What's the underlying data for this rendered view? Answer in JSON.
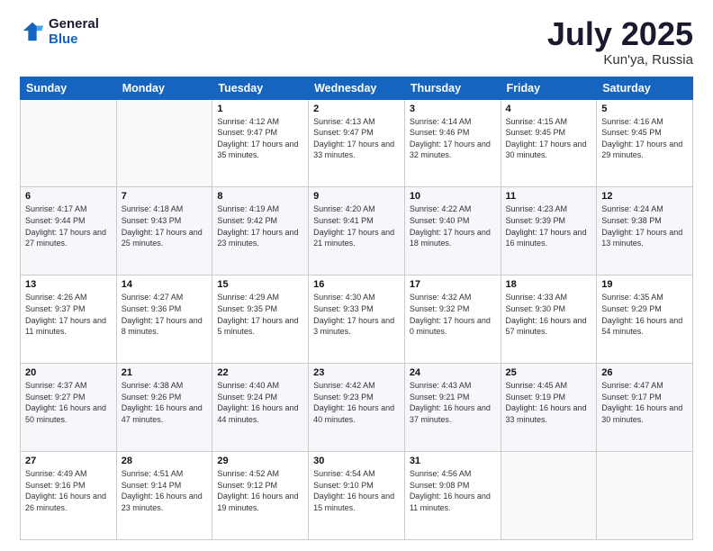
{
  "header": {
    "logo_line1": "General",
    "logo_line2": "Blue",
    "month_year": "July 2025",
    "location": "Kun'ya, Russia"
  },
  "weekdays": [
    "Sunday",
    "Monday",
    "Tuesday",
    "Wednesday",
    "Thursday",
    "Friday",
    "Saturday"
  ],
  "weeks": [
    [
      {
        "day": "",
        "sunrise": "",
        "sunset": "",
        "daylight": ""
      },
      {
        "day": "",
        "sunrise": "",
        "sunset": "",
        "daylight": ""
      },
      {
        "day": "1",
        "sunrise": "Sunrise: 4:12 AM",
        "sunset": "Sunset: 9:47 PM",
        "daylight": "Daylight: 17 hours and 35 minutes."
      },
      {
        "day": "2",
        "sunrise": "Sunrise: 4:13 AM",
        "sunset": "Sunset: 9:47 PM",
        "daylight": "Daylight: 17 hours and 33 minutes."
      },
      {
        "day": "3",
        "sunrise": "Sunrise: 4:14 AM",
        "sunset": "Sunset: 9:46 PM",
        "daylight": "Daylight: 17 hours and 32 minutes."
      },
      {
        "day": "4",
        "sunrise": "Sunrise: 4:15 AM",
        "sunset": "Sunset: 9:45 PM",
        "daylight": "Daylight: 17 hours and 30 minutes."
      },
      {
        "day": "5",
        "sunrise": "Sunrise: 4:16 AM",
        "sunset": "Sunset: 9:45 PM",
        "daylight": "Daylight: 17 hours and 29 minutes."
      }
    ],
    [
      {
        "day": "6",
        "sunrise": "Sunrise: 4:17 AM",
        "sunset": "Sunset: 9:44 PM",
        "daylight": "Daylight: 17 hours and 27 minutes."
      },
      {
        "day": "7",
        "sunrise": "Sunrise: 4:18 AM",
        "sunset": "Sunset: 9:43 PM",
        "daylight": "Daylight: 17 hours and 25 minutes."
      },
      {
        "day": "8",
        "sunrise": "Sunrise: 4:19 AM",
        "sunset": "Sunset: 9:42 PM",
        "daylight": "Daylight: 17 hours and 23 minutes."
      },
      {
        "day": "9",
        "sunrise": "Sunrise: 4:20 AM",
        "sunset": "Sunset: 9:41 PM",
        "daylight": "Daylight: 17 hours and 21 minutes."
      },
      {
        "day": "10",
        "sunrise": "Sunrise: 4:22 AM",
        "sunset": "Sunset: 9:40 PM",
        "daylight": "Daylight: 17 hours and 18 minutes."
      },
      {
        "day": "11",
        "sunrise": "Sunrise: 4:23 AM",
        "sunset": "Sunset: 9:39 PM",
        "daylight": "Daylight: 17 hours and 16 minutes."
      },
      {
        "day": "12",
        "sunrise": "Sunrise: 4:24 AM",
        "sunset": "Sunset: 9:38 PM",
        "daylight": "Daylight: 17 hours and 13 minutes."
      }
    ],
    [
      {
        "day": "13",
        "sunrise": "Sunrise: 4:26 AM",
        "sunset": "Sunset: 9:37 PM",
        "daylight": "Daylight: 17 hours and 11 minutes."
      },
      {
        "day": "14",
        "sunrise": "Sunrise: 4:27 AM",
        "sunset": "Sunset: 9:36 PM",
        "daylight": "Daylight: 17 hours and 8 minutes."
      },
      {
        "day": "15",
        "sunrise": "Sunrise: 4:29 AM",
        "sunset": "Sunset: 9:35 PM",
        "daylight": "Daylight: 17 hours and 5 minutes."
      },
      {
        "day": "16",
        "sunrise": "Sunrise: 4:30 AM",
        "sunset": "Sunset: 9:33 PM",
        "daylight": "Daylight: 17 hours and 3 minutes."
      },
      {
        "day": "17",
        "sunrise": "Sunrise: 4:32 AM",
        "sunset": "Sunset: 9:32 PM",
        "daylight": "Daylight: 17 hours and 0 minutes."
      },
      {
        "day": "18",
        "sunrise": "Sunrise: 4:33 AM",
        "sunset": "Sunset: 9:30 PM",
        "daylight": "Daylight: 16 hours and 57 minutes."
      },
      {
        "day": "19",
        "sunrise": "Sunrise: 4:35 AM",
        "sunset": "Sunset: 9:29 PM",
        "daylight": "Daylight: 16 hours and 54 minutes."
      }
    ],
    [
      {
        "day": "20",
        "sunrise": "Sunrise: 4:37 AM",
        "sunset": "Sunset: 9:27 PM",
        "daylight": "Daylight: 16 hours and 50 minutes."
      },
      {
        "day": "21",
        "sunrise": "Sunrise: 4:38 AM",
        "sunset": "Sunset: 9:26 PM",
        "daylight": "Daylight: 16 hours and 47 minutes."
      },
      {
        "day": "22",
        "sunrise": "Sunrise: 4:40 AM",
        "sunset": "Sunset: 9:24 PM",
        "daylight": "Daylight: 16 hours and 44 minutes."
      },
      {
        "day": "23",
        "sunrise": "Sunrise: 4:42 AM",
        "sunset": "Sunset: 9:23 PM",
        "daylight": "Daylight: 16 hours and 40 minutes."
      },
      {
        "day": "24",
        "sunrise": "Sunrise: 4:43 AM",
        "sunset": "Sunset: 9:21 PM",
        "daylight": "Daylight: 16 hours and 37 minutes."
      },
      {
        "day": "25",
        "sunrise": "Sunrise: 4:45 AM",
        "sunset": "Sunset: 9:19 PM",
        "daylight": "Daylight: 16 hours and 33 minutes."
      },
      {
        "day": "26",
        "sunrise": "Sunrise: 4:47 AM",
        "sunset": "Sunset: 9:17 PM",
        "daylight": "Daylight: 16 hours and 30 minutes."
      }
    ],
    [
      {
        "day": "27",
        "sunrise": "Sunrise: 4:49 AM",
        "sunset": "Sunset: 9:16 PM",
        "daylight": "Daylight: 16 hours and 26 minutes."
      },
      {
        "day": "28",
        "sunrise": "Sunrise: 4:51 AM",
        "sunset": "Sunset: 9:14 PM",
        "daylight": "Daylight: 16 hours and 23 minutes."
      },
      {
        "day": "29",
        "sunrise": "Sunrise: 4:52 AM",
        "sunset": "Sunset: 9:12 PM",
        "daylight": "Daylight: 16 hours and 19 minutes."
      },
      {
        "day": "30",
        "sunrise": "Sunrise: 4:54 AM",
        "sunset": "Sunset: 9:10 PM",
        "daylight": "Daylight: 16 hours and 15 minutes."
      },
      {
        "day": "31",
        "sunrise": "Sunrise: 4:56 AM",
        "sunset": "Sunset: 9:08 PM",
        "daylight": "Daylight: 16 hours and 11 minutes."
      },
      {
        "day": "",
        "sunrise": "",
        "sunset": "",
        "daylight": ""
      },
      {
        "day": "",
        "sunrise": "",
        "sunset": "",
        "daylight": ""
      }
    ]
  ]
}
